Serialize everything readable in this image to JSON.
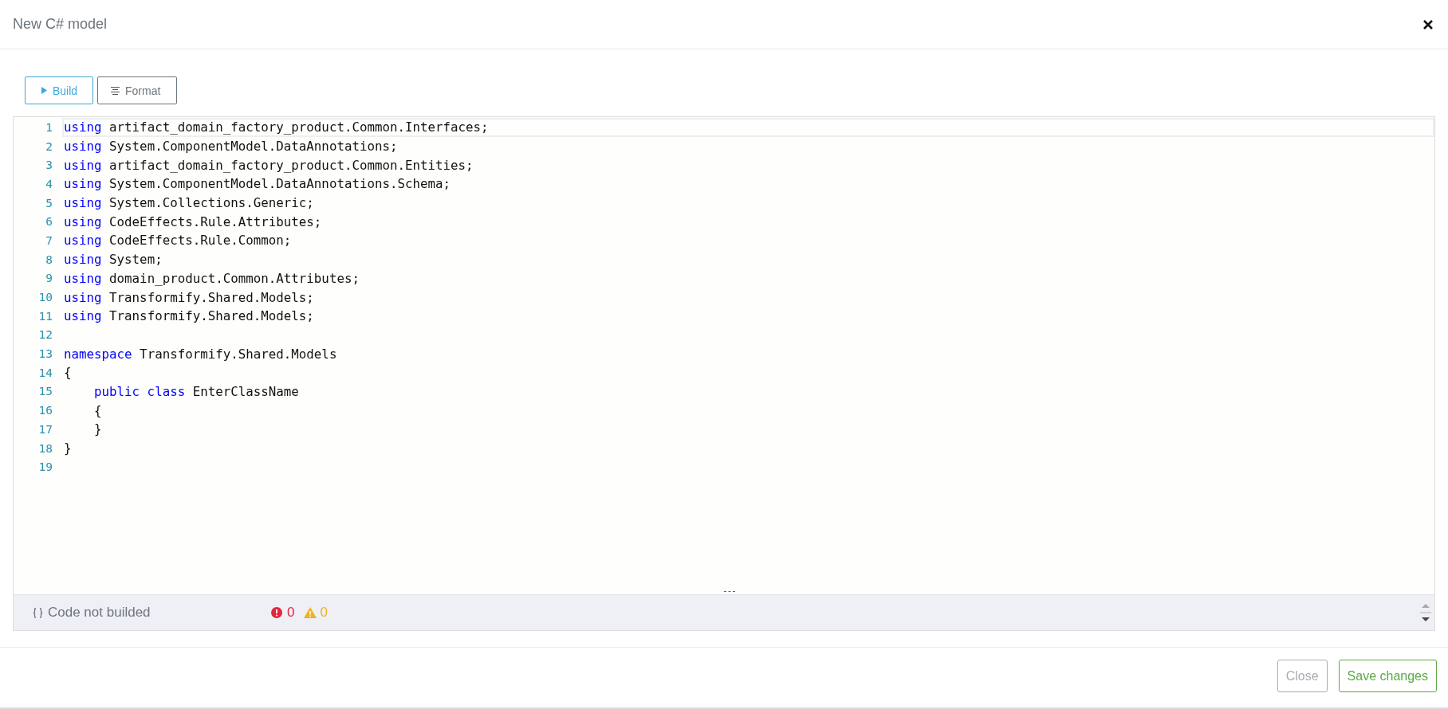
{
  "window": {
    "title": "New C# model"
  },
  "toolbar": [
    {
      "label": "Build",
      "kind": "build"
    },
    {
      "label": "Format",
      "kind": "format"
    }
  ],
  "editor": {
    "lines": [
      {
        "number": "1",
        "current": true,
        "tokens": [
          {
            "text": "using",
            "kind": "keyword"
          },
          {
            "text": " artifact_domain_factory_product.Common.Interfaces;",
            "kind": "plain"
          }
        ]
      },
      {
        "number": "2",
        "current": false,
        "tokens": [
          {
            "text": "using",
            "kind": "keyword"
          },
          {
            "text": " System.ComponentModel.DataAnnotations;",
            "kind": "plain"
          }
        ]
      },
      {
        "number": "3",
        "current": false,
        "tokens": [
          {
            "text": "using",
            "kind": "keyword"
          },
          {
            "text": " artifact_domain_factory_product.Common.Entities;",
            "kind": "plain"
          }
        ]
      },
      {
        "number": "4",
        "current": false,
        "tokens": [
          {
            "text": "using",
            "kind": "keyword"
          },
          {
            "text": " System.ComponentModel.DataAnnotations.Schema;",
            "kind": "plain"
          }
        ]
      },
      {
        "number": "5",
        "current": false,
        "tokens": [
          {
            "text": "using",
            "kind": "keyword"
          },
          {
            "text": " System.Collections.Generic;",
            "kind": "plain"
          }
        ]
      },
      {
        "number": "6",
        "current": false,
        "tokens": [
          {
            "text": "using",
            "kind": "keyword"
          },
          {
            "text": " CodeEffects.Rule.Attributes;",
            "kind": "plain"
          }
        ]
      },
      {
        "number": "7",
        "current": false,
        "tokens": [
          {
            "text": "using",
            "kind": "keyword"
          },
          {
            "text": " CodeEffects.Rule.Common;",
            "kind": "plain"
          }
        ]
      },
      {
        "number": "8",
        "current": false,
        "tokens": [
          {
            "text": "using",
            "kind": "keyword"
          },
          {
            "text": " System;",
            "kind": "plain"
          }
        ]
      },
      {
        "number": "9",
        "current": false,
        "tokens": [
          {
            "text": "using",
            "kind": "keyword"
          },
          {
            "text": " domain_product.Common.Attributes;",
            "kind": "plain"
          }
        ]
      },
      {
        "number": "10",
        "current": false,
        "tokens": [
          {
            "text": "using",
            "kind": "keyword"
          },
          {
            "text": " Transformify.Shared.Models;",
            "kind": "plain"
          }
        ]
      },
      {
        "number": "11",
        "current": false,
        "tokens": [
          {
            "text": "using",
            "kind": "keyword"
          },
          {
            "text": " Transformify.Shared.Models;",
            "kind": "plain"
          }
        ]
      },
      {
        "number": "12",
        "current": false
      },
      {
        "number": "13",
        "current": false,
        "tokens": [
          {
            "text": "namespace",
            "kind": "keyword"
          },
          {
            "text": " Transformify.Shared.Models",
            "kind": "plain"
          }
        ]
      },
      {
        "number": "14",
        "current": false,
        "tokens": [
          {
            "text": "{",
            "kind": "plain"
          }
        ]
      },
      {
        "number": "15",
        "current": false,
        "tokens": [
          {
            "text": "    public class",
            "kind": "keyword"
          },
          {
            "text": " EnterClassName",
            "kind": "plain"
          }
        ]
      },
      {
        "number": "16",
        "current": false,
        "tokens": [
          {
            "text": "    {",
            "kind": "plain"
          }
        ]
      },
      {
        "number": "17",
        "current": false,
        "tokens": [
          {
            "text": "    }",
            "kind": "plain"
          }
        ]
      },
      {
        "number": "18",
        "current": false,
        "tokens": [
          {
            "text": "}",
            "kind": "plain"
          }
        ]
      },
      {
        "number": "19",
        "current": false
      }
    ]
  },
  "status_bar": {
    "message": "Code not builded",
    "errors": "0",
    "warnings": "0"
  },
  "footer": {
    "buttons": [
      {
        "label": "Close",
        "kind": "close",
        "disabled": true
      },
      {
        "label": "Save changes",
        "kind": "save",
        "disabled": false
      }
    ]
  }
}
